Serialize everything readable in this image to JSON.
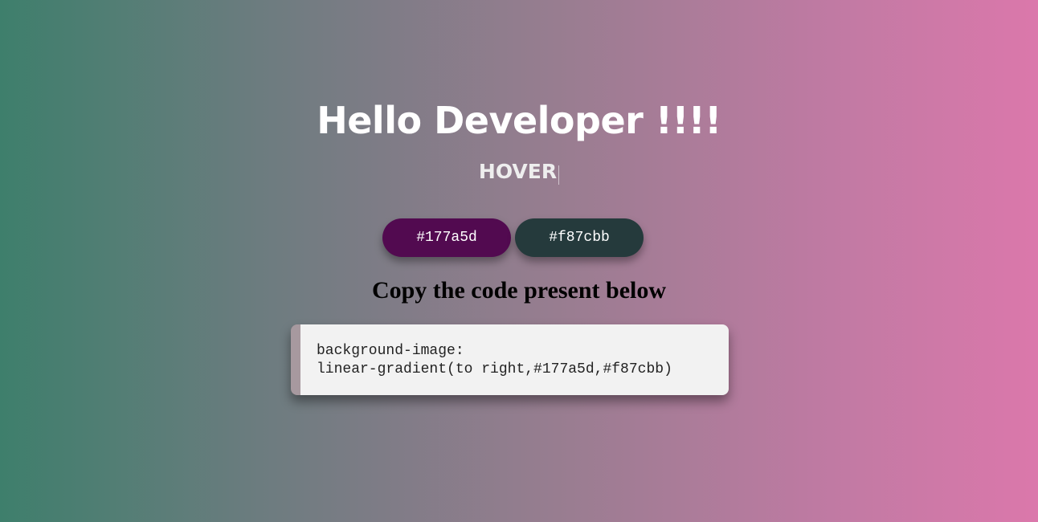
{
  "page": {
    "title": "Hello Developer !!!!",
    "hover_label": "HOVER"
  },
  "buttons": [
    {
      "label": "#177a5d",
      "color": "#520a50"
    },
    {
      "label": "#f87cbb",
      "color": "#253a3c"
    }
  ],
  "subtitle": "Copy the code present below",
  "code": {
    "line1": "background-image:",
    "line2": "linear-gradient(to right,#177a5d,#f87cbb)"
  },
  "colors": {
    "gradient_left": "#3e7f6c",
    "gradient_right": "#db78ab",
    "code_box_bg": "#f2f2f2",
    "code_box_accent": "#a7999f"
  }
}
